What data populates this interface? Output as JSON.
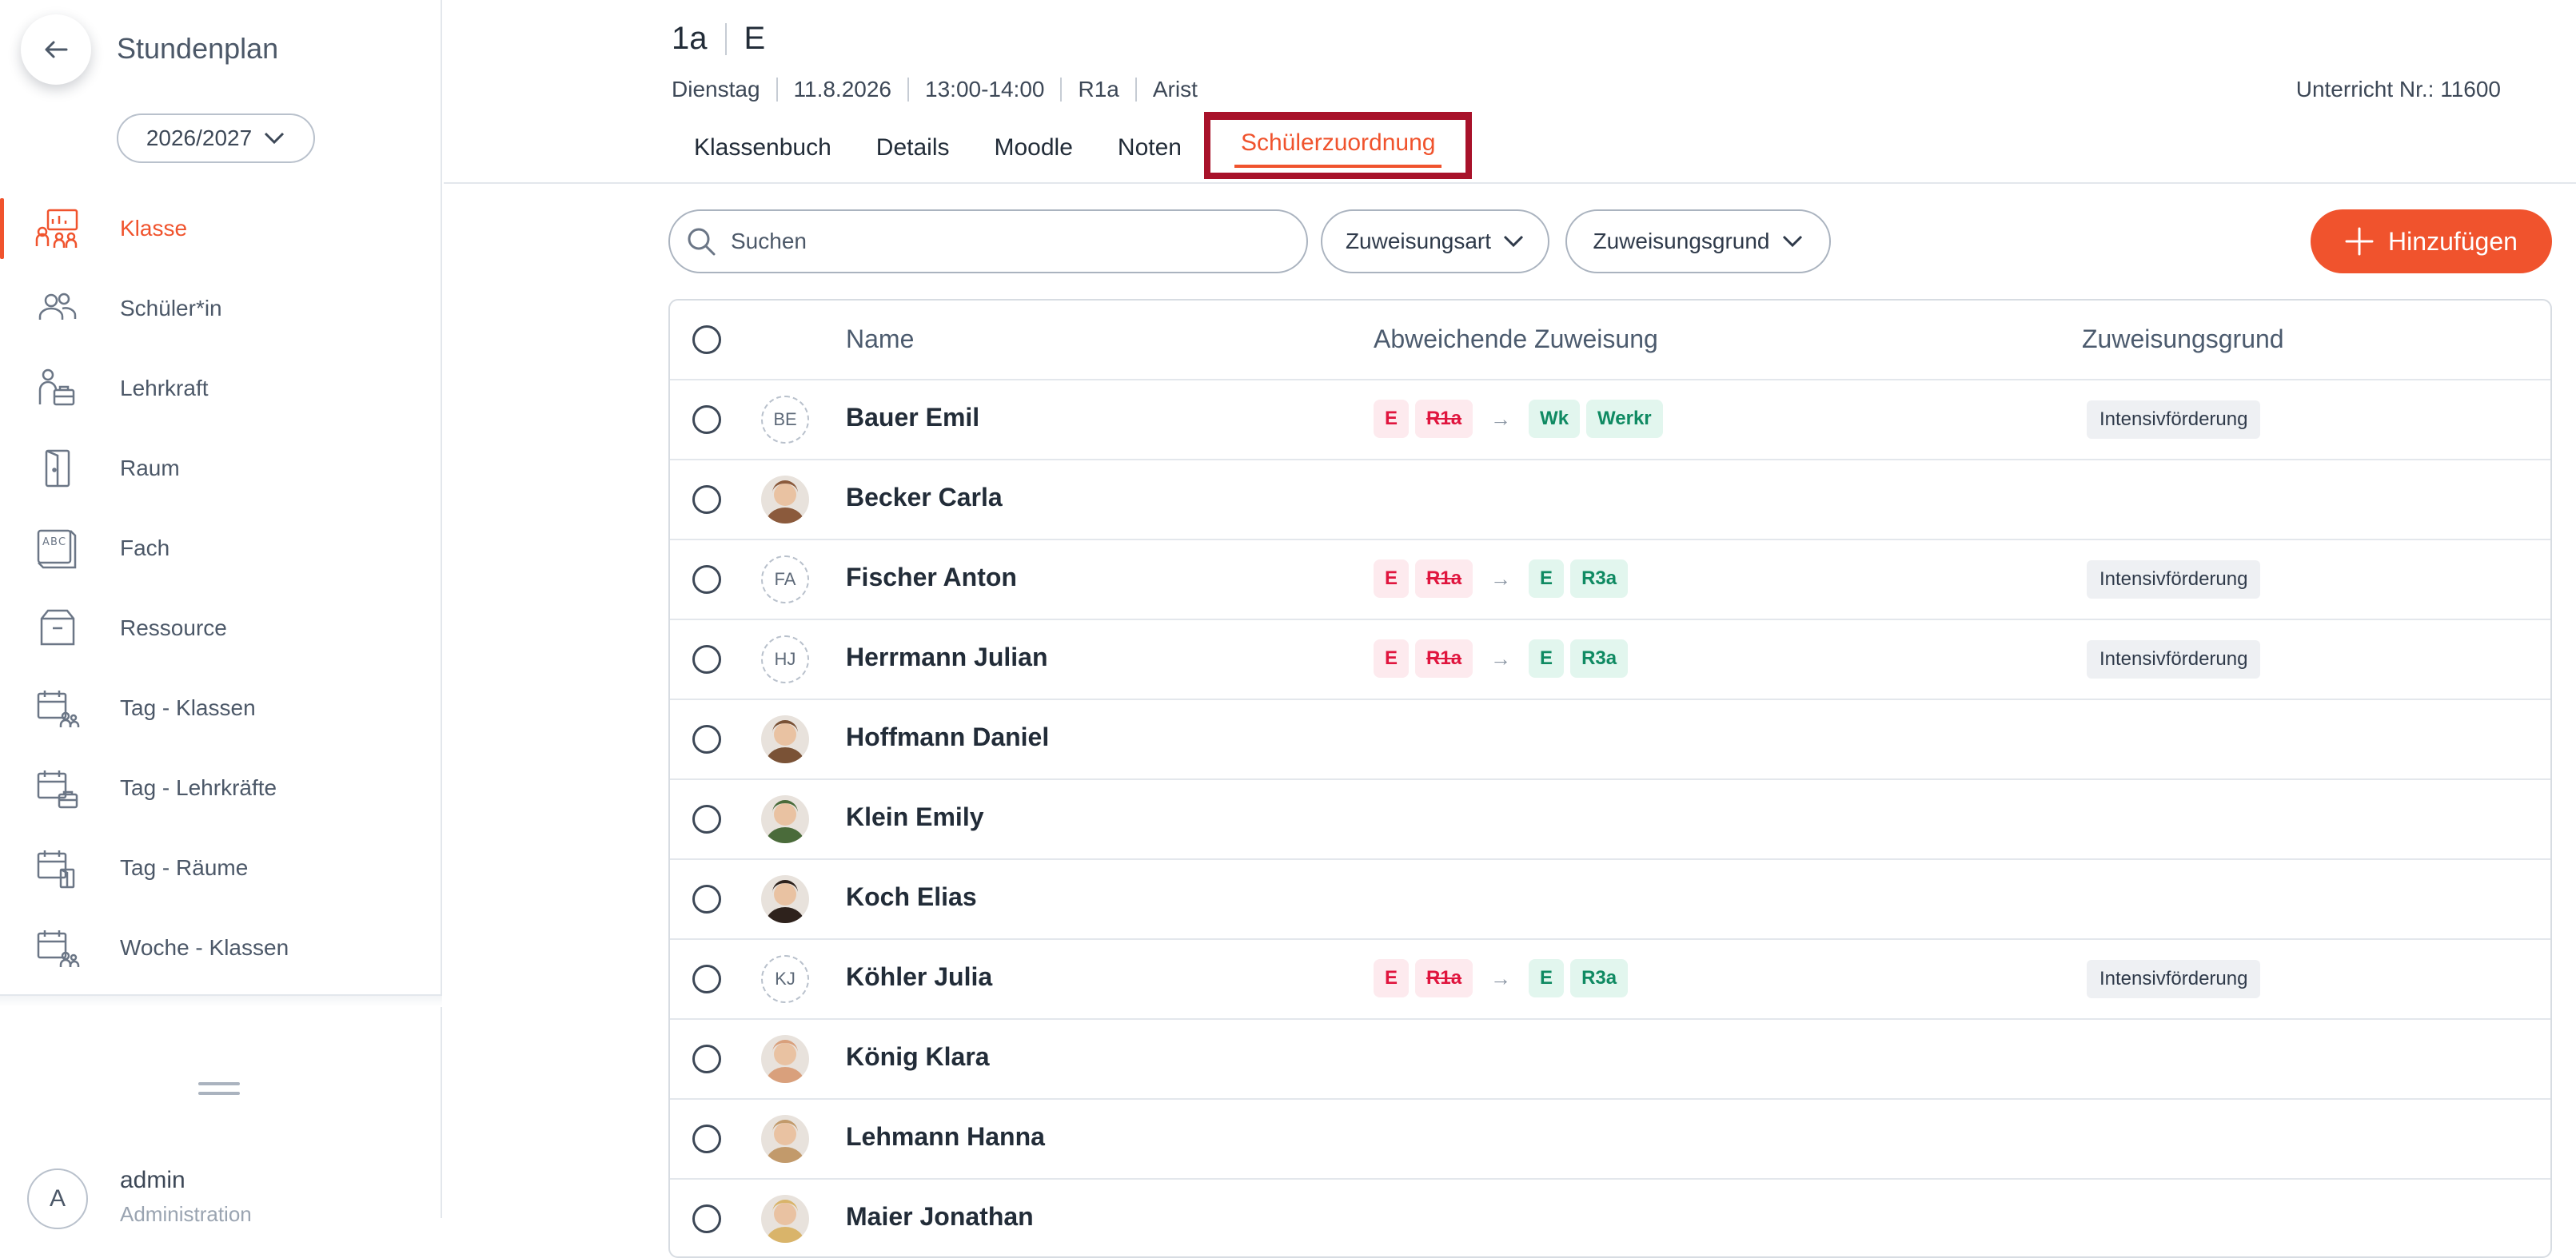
{
  "sidebar": {
    "back_icon": "arrow-left-icon",
    "title": "Stundenplan",
    "year": "2026/2027",
    "items": [
      {
        "label": "Klasse",
        "icon": "class-board-icon",
        "active": true
      },
      {
        "label": "Schüler*in",
        "icon": "students-icon"
      },
      {
        "label": "Lehrkraft",
        "icon": "teacher-icon"
      },
      {
        "label": "Raum",
        "icon": "door-icon"
      },
      {
        "label": "Fach",
        "icon": "subject-abc-icon"
      },
      {
        "label": "Ressource",
        "icon": "box-icon"
      },
      {
        "label": "Tag - Klassen",
        "icon": "calendar-group-icon"
      },
      {
        "label": "Tag - Lehrkräfte",
        "icon": "calendar-teacher-icon"
      },
      {
        "label": "Tag - Räume",
        "icon": "calendar-room-icon"
      },
      {
        "label": "Woche - Klassen",
        "icon": "calendar-week-icon"
      }
    ],
    "user": {
      "initial": "A",
      "name": "admin",
      "role": "Administration"
    }
  },
  "header": {
    "class": "1a",
    "subject": "E",
    "meta": [
      "Dienstag",
      "11.8.2026",
      "13:00-14:00",
      "R1a",
      "Arist"
    ],
    "lesson_nr": "Unterricht Nr.: 11600",
    "tabs": [
      {
        "label": "Klassenbuch"
      },
      {
        "label": "Details"
      },
      {
        "label": "Moodle"
      },
      {
        "label": "Noten"
      },
      {
        "label": "Schülerzuordnung",
        "active": true
      }
    ]
  },
  "toolbar": {
    "search_placeholder": "Suchen",
    "filter_type": "Zuweisungsart",
    "filter_reason": "Zuweisungsgrund",
    "add_label": "Hinzufügen"
  },
  "table": {
    "columns": {
      "name": "Name",
      "assignment": "Abweichende Zuweisung",
      "reason": "Zuweisungsgrund"
    },
    "rows": [
      {
        "name": "Bauer Emil",
        "initials": "BE",
        "from": [
          "E",
          "R1a"
        ],
        "to": [
          "Wk",
          "Werkr"
        ],
        "reason": "Intensivförderung"
      },
      {
        "name": "Becker Carla",
        "photo": "#8b5a3c"
      },
      {
        "name": "Fischer Anton",
        "initials": "FA",
        "from": [
          "E",
          "R1a"
        ],
        "to": [
          "E",
          "R3a"
        ],
        "reason": "Intensivförderung"
      },
      {
        "name": "Herrmann Julian",
        "initials": "HJ",
        "from": [
          "E",
          "R1a"
        ],
        "to": [
          "E",
          "R3a"
        ],
        "reason": "Intensivförderung"
      },
      {
        "name": "Hoffmann Daniel",
        "photo": "#7a5236"
      },
      {
        "name": "Klein Emily",
        "photo": "#4a6b3a"
      },
      {
        "name": "Koch Elias",
        "photo": "#2e221c"
      },
      {
        "name": "Köhler Julia",
        "initials": "KJ",
        "from": [
          "E",
          "R1a"
        ],
        "to": [
          "E",
          "R3a"
        ],
        "reason": "Intensivförderung"
      },
      {
        "name": "König Klara",
        "photo": "#d9a07c"
      },
      {
        "name": "Lehmann Hanna",
        "photo": "#c29a6b"
      },
      {
        "name": "Maier Jonathan",
        "photo": "#d9b46a"
      }
    ]
  },
  "colors": {
    "accent": "#f0532d",
    "tab_highlight": "#a8122a",
    "chip_red": "#e0153e",
    "chip_green": "#0f8a62"
  }
}
